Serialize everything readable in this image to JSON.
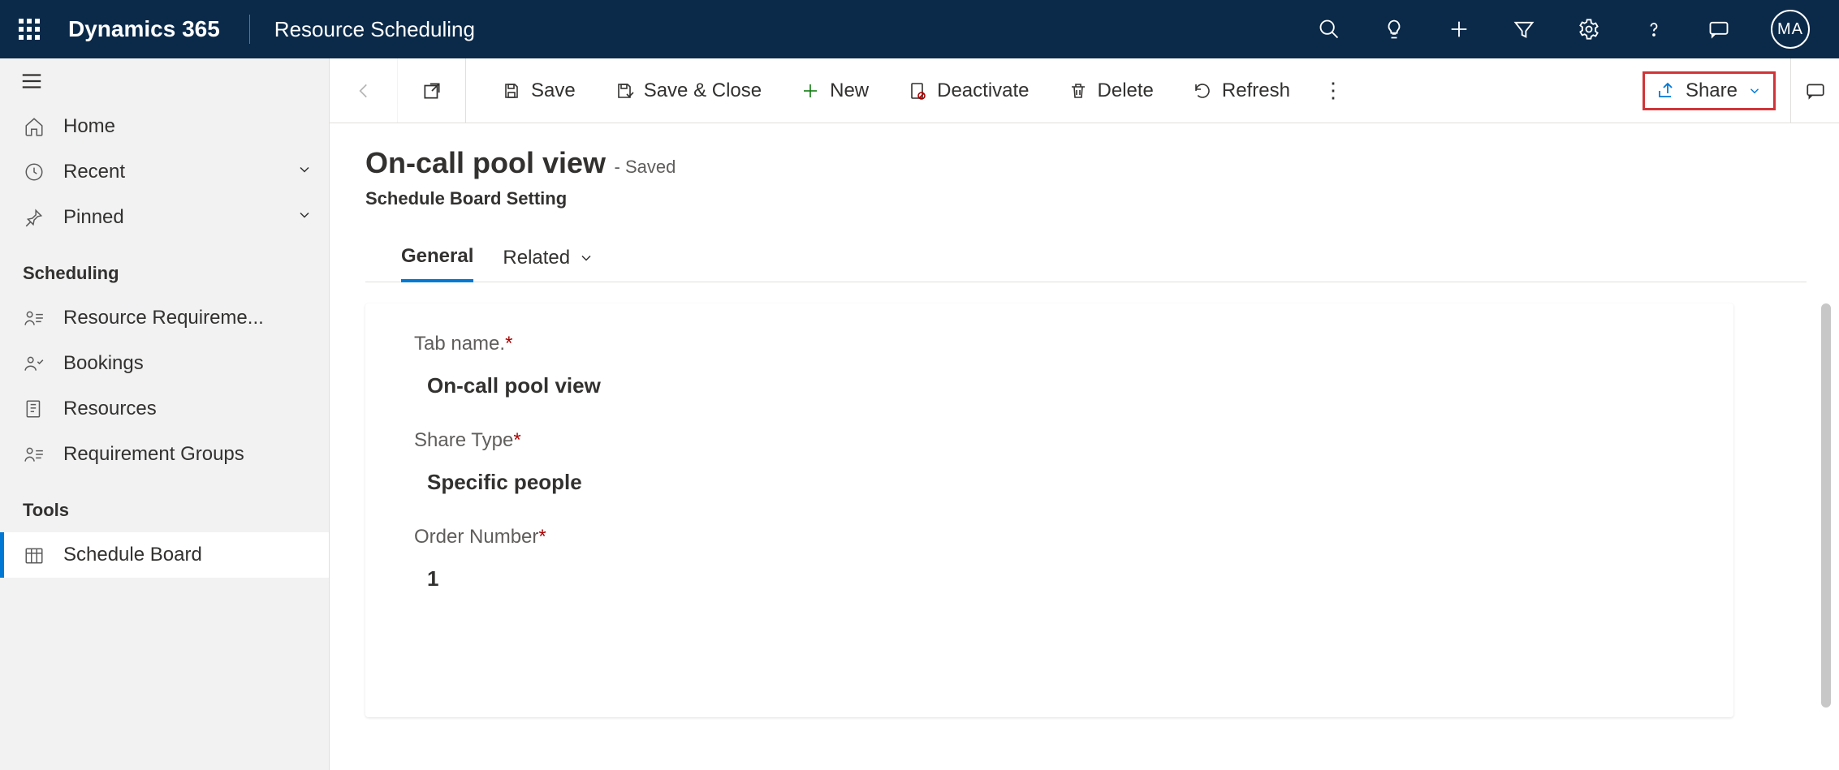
{
  "top": {
    "brand": "Dynamics 365",
    "app": "Resource Scheduling",
    "avatar_initials": "MA"
  },
  "sidebar": {
    "home": "Home",
    "recent": "Recent",
    "pinned": "Pinned",
    "section_scheduling": "Scheduling",
    "items": {
      "resource_requirements": "Resource Requireme...",
      "bookings": "Bookings",
      "resources": "Resources",
      "requirement_groups": "Requirement Groups"
    },
    "section_tools": "Tools",
    "schedule_board": "Schedule Board"
  },
  "cmd": {
    "save": "Save",
    "save_close": "Save & Close",
    "new": "New",
    "deactivate": "Deactivate",
    "delete": "Delete",
    "refresh": "Refresh",
    "share": "Share"
  },
  "head": {
    "title": "On-call pool view",
    "state": "- Saved",
    "subtitle": "Schedule Board Setting"
  },
  "tabs": {
    "general": "General",
    "related": "Related"
  },
  "form": {
    "tab_name_label": "Tab name.",
    "tab_name_value": "On-call pool view",
    "share_type_label": "Share Type",
    "share_type_value": "Specific people",
    "order_number_label": "Order Number",
    "order_number_value": "1"
  }
}
